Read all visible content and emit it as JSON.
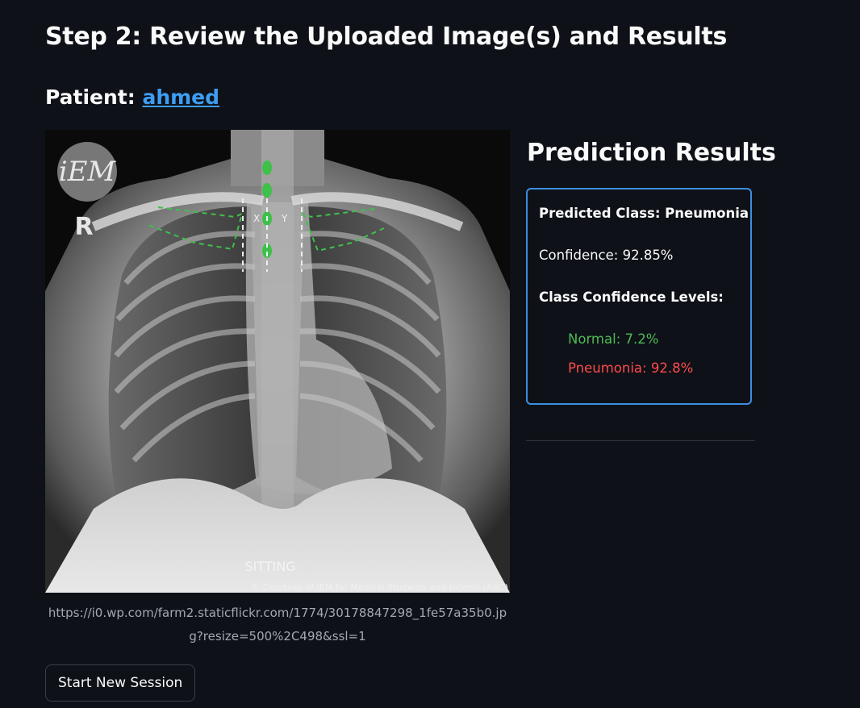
{
  "step_title": "Step 2: Review the Uploaded Image(s) and Results",
  "patient": {
    "label": "Patient: ",
    "name": "ahmed"
  },
  "image": {
    "watermark_logo": "iEM",
    "side_marker": "R",
    "marker_x": "X",
    "marker_y": "Y",
    "position_label": "SITTING",
    "credit": "© Courtesy of IEM for Medical Students and Interns (AAC)",
    "caption": "https://i0.wp.com/farm2.staticflickr.com/1774/30178847298_1fe57a35b0.jpg?resize=500%2C498&ssl=1"
  },
  "results": {
    "heading": "Prediction Results",
    "predicted_class_label": "Predicted Class: Pneumonia",
    "confidence_label": "Confidence: 92.85%",
    "levels_heading": "Class Confidence Levels:",
    "levels": [
      {
        "text": "Normal: 7.2%",
        "color": "#4ebb55"
      },
      {
        "text": "Pneumonia: 92.8%",
        "color": "#ff4b4b"
      }
    ]
  },
  "buttons": {
    "new_session": "Start New Session"
  },
  "colors": {
    "background": "#0e1117",
    "link": "#3d9df3",
    "card_border": "#3b8fe0",
    "overlay_green": "#3ec04a"
  }
}
